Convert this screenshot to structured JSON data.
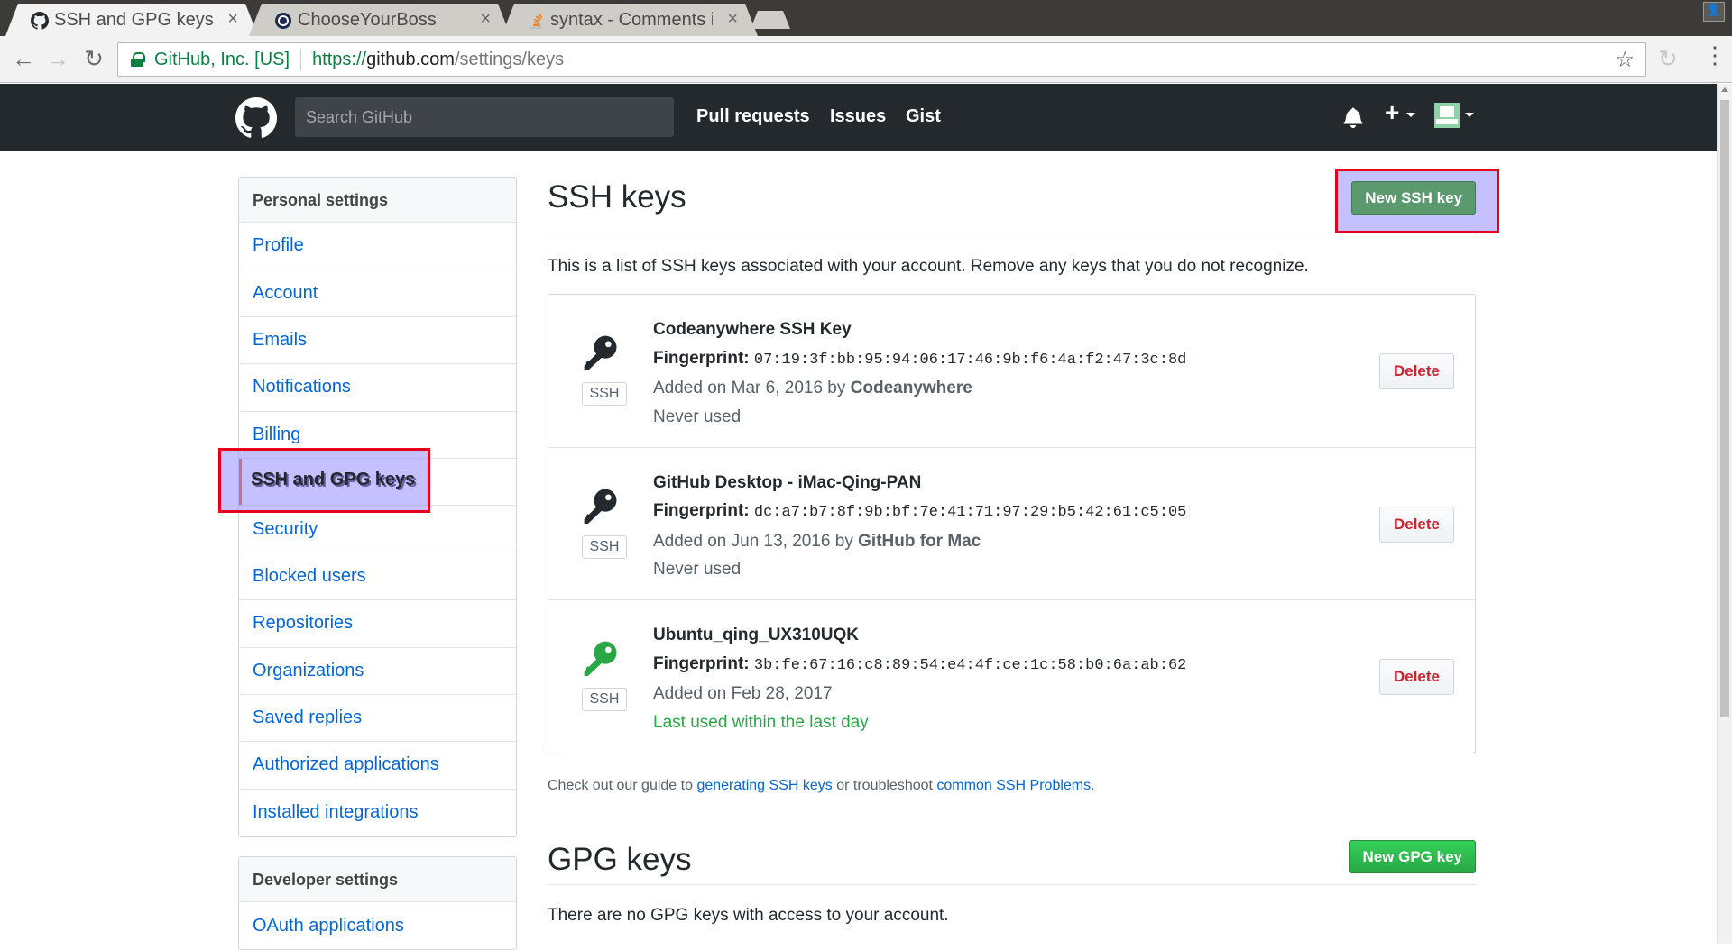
{
  "browser": {
    "tabs": [
      {
        "title": "SSH and GPG keys",
        "icon": "github-icon",
        "active": true
      },
      {
        "title": "ChooseYourBoss",
        "icon": "chooseyourboss-icon",
        "active": false
      },
      {
        "title": "syntax - Comments in",
        "icon": "stackoverflow-icon",
        "active": false
      }
    ],
    "close_glyph": "×",
    "org": "GitHub, Inc. [US]",
    "url_scheme": "https://",
    "url_host": "github.com",
    "url_path": "/settings/keys"
  },
  "header": {
    "search_placeholder": "Search GitHub",
    "nav": [
      "Pull requests",
      "Issues",
      "Gist"
    ],
    "plus_glyph": "+"
  },
  "sidebar": {
    "personal_heading": "Personal settings",
    "personal_items": [
      "Profile",
      "Account",
      "Emails",
      "Notifications",
      "Billing",
      "SSH and GPG keys",
      "Security",
      "Blocked users",
      "Repositories",
      "Organizations",
      "Saved replies",
      "Authorized applications",
      "Installed integrations"
    ],
    "selected": "SSH and GPG keys",
    "developer_heading": "Developer settings",
    "developer_items": [
      "OAuth applications"
    ]
  },
  "ssh": {
    "title": "SSH keys",
    "new_button": "New SSH key",
    "intro": "This is a list of SSH keys associated with your account. Remove any keys that you do not recognize.",
    "fingerprint_label": "Fingerprint:",
    "type_label": "SSH",
    "delete_label": "Delete",
    "keys": [
      {
        "name": "Codeanywhere SSH Key",
        "fingerprint": "07:19:3f:bb:95:94:06:17:46:9b:f6:4a:f2:47:3c:8d",
        "added": "Added on Mar 6, 2016 by",
        "added_by": "Codeanywhere",
        "usage": "Never used",
        "recent": false,
        "icon_color": "#24292e"
      },
      {
        "name": "GitHub Desktop - iMac-Qing-PAN",
        "fingerprint": "dc:a7:b7:8f:9b:bf:7e:41:71:97:29:b5:42:61:c5:05",
        "added": "Added on Jun 13, 2016 by",
        "added_by": "GitHub for Mac",
        "usage": "Never used",
        "recent": false,
        "icon_color": "#24292e"
      },
      {
        "name": "Ubuntu_qing_UX310UQK",
        "fingerprint": "3b:fe:67:16:c8:89:54:e4:4f:ce:1c:58:b0:6a:ab:62",
        "added": "Added on Feb 28, 2017",
        "added_by": "",
        "usage": "Last used within the last day",
        "recent": true,
        "icon_color": "#28a745"
      }
    ],
    "guide_prefix": "Check out our guide to",
    "guide_link1": "generating SSH keys",
    "guide_middle": "or troubleshoot",
    "guide_link2": "common SSH Problems",
    "guide_suffix": "."
  },
  "gpg": {
    "title": "GPG keys",
    "new_button": "New GPG key",
    "empty_text": "There are no GPG keys with access to your account."
  },
  "colors": {
    "header_bg": "#24292e",
    "link": "#0366d6",
    "primary": "#28a745",
    "danger": "#cb2431",
    "highlight_border": "#e5001e"
  }
}
